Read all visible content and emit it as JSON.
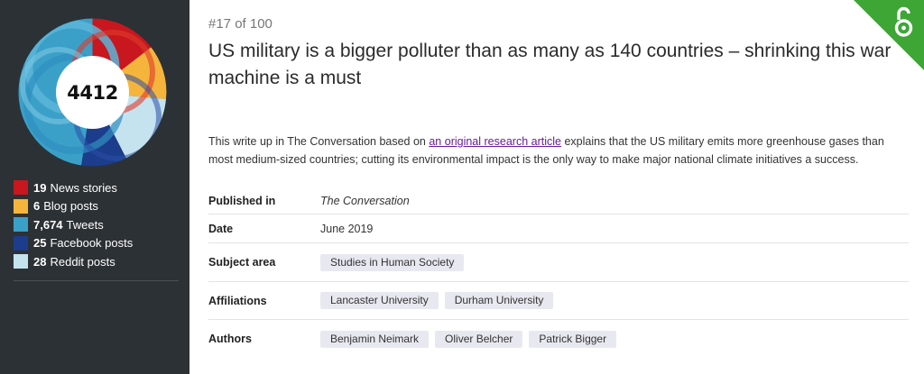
{
  "score": {
    "value": "4412"
  },
  "legend": [
    {
      "count": "19",
      "label": "News stories",
      "color": "#c8171e"
    },
    {
      "count": "6",
      "label": "Blog posts",
      "color": "#f5b53d"
    },
    {
      "count": "7,674",
      "label": "Tweets",
      "color": "#3ba0c8"
    },
    {
      "count": "25",
      "label": "Facebook posts",
      "color": "#1c3c8c"
    },
    {
      "count": "28",
      "label": "Reddit posts",
      "color": "#c5e3ef"
    }
  ],
  "article": {
    "rank": "#17 of 100",
    "title": "US military is a bigger polluter than as many as 140 countries – shrinking this war machine is a must",
    "description_pre": "This write up in The Conversation based on ",
    "description_link": "an original research article",
    "description_post": " explains that the US military emits more greenhouse gases than most medium-sized countries; cutting its environmental impact is the only way to make major national climate initiatives a success."
  },
  "meta": {
    "published_label": "Published in",
    "published_value": "The Conversation",
    "date_label": "Date",
    "date_value": "June 2019",
    "subject_label": "Subject area",
    "subjects": [
      "Studies in Human Society"
    ],
    "affiliations_label": "Affiliations",
    "affiliations": [
      "Lancaster University",
      "Durham University"
    ],
    "authors_label": "Authors",
    "authors": [
      "Benjamin Neimark",
      "Oliver Belcher",
      "Patrick Bigger"
    ]
  },
  "colors": {
    "sidebar_bg": "#2c3135",
    "open_access_green": "#3da635",
    "link": "#6a1b9a"
  },
  "icons": {
    "open_access": "open-access-lock-icon"
  }
}
